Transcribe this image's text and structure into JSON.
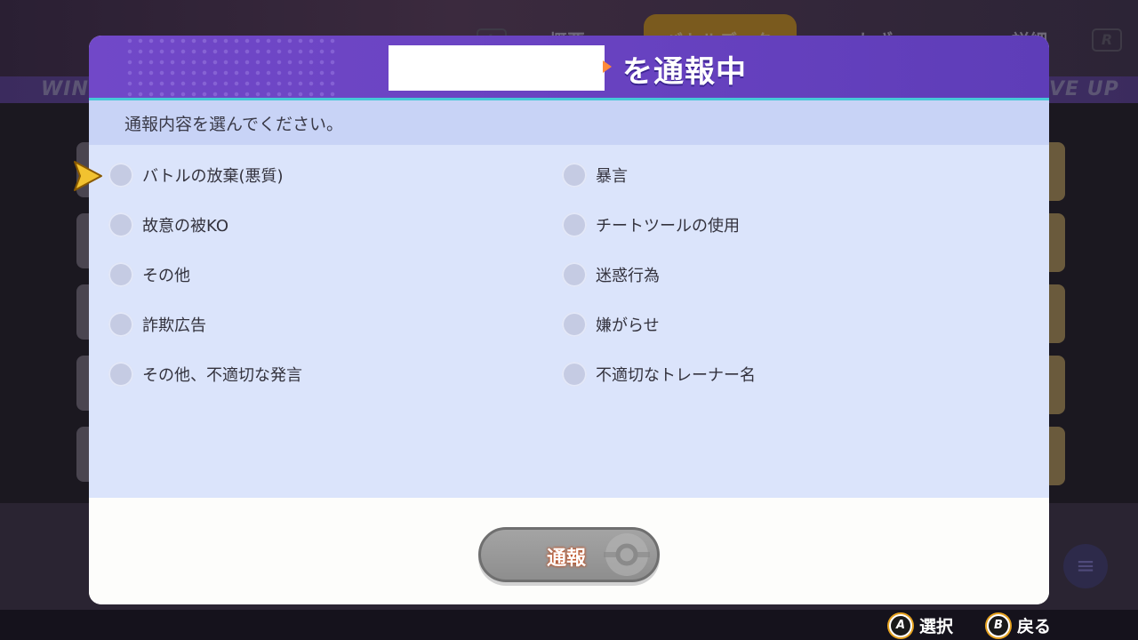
{
  "background": {
    "tabs": [
      "概要",
      "バトルデータ",
      "わざ",
      "詳細"
    ],
    "left_key": "L",
    "right_key": "R",
    "band_left": "WIN",
    "band_right": "VE UP"
  },
  "dialog": {
    "title_suffix": "を通報中",
    "instruction": "通報内容を選んでください。",
    "options_left": [
      "バトルの放棄(悪質)",
      "故意の被KO",
      "その他",
      "詐欺広告",
      "その他、不適切な発言"
    ],
    "options_right": [
      "暴言",
      "チートツールの使用",
      "迷惑行為",
      "嫌がらせ",
      "不適切なトレーナー名"
    ],
    "report_button": "通報"
  },
  "hints": {
    "select_key": "A",
    "select_label": "選択",
    "back_key": "B",
    "back_label": "戻る"
  },
  "colors": {
    "header": "#6a43c2",
    "header_border": "#46c9d8",
    "instruction_bg": "#c8d3f6",
    "options_bg": "#dbe4fb",
    "cursor": "#f2c230",
    "button": "#999999"
  }
}
